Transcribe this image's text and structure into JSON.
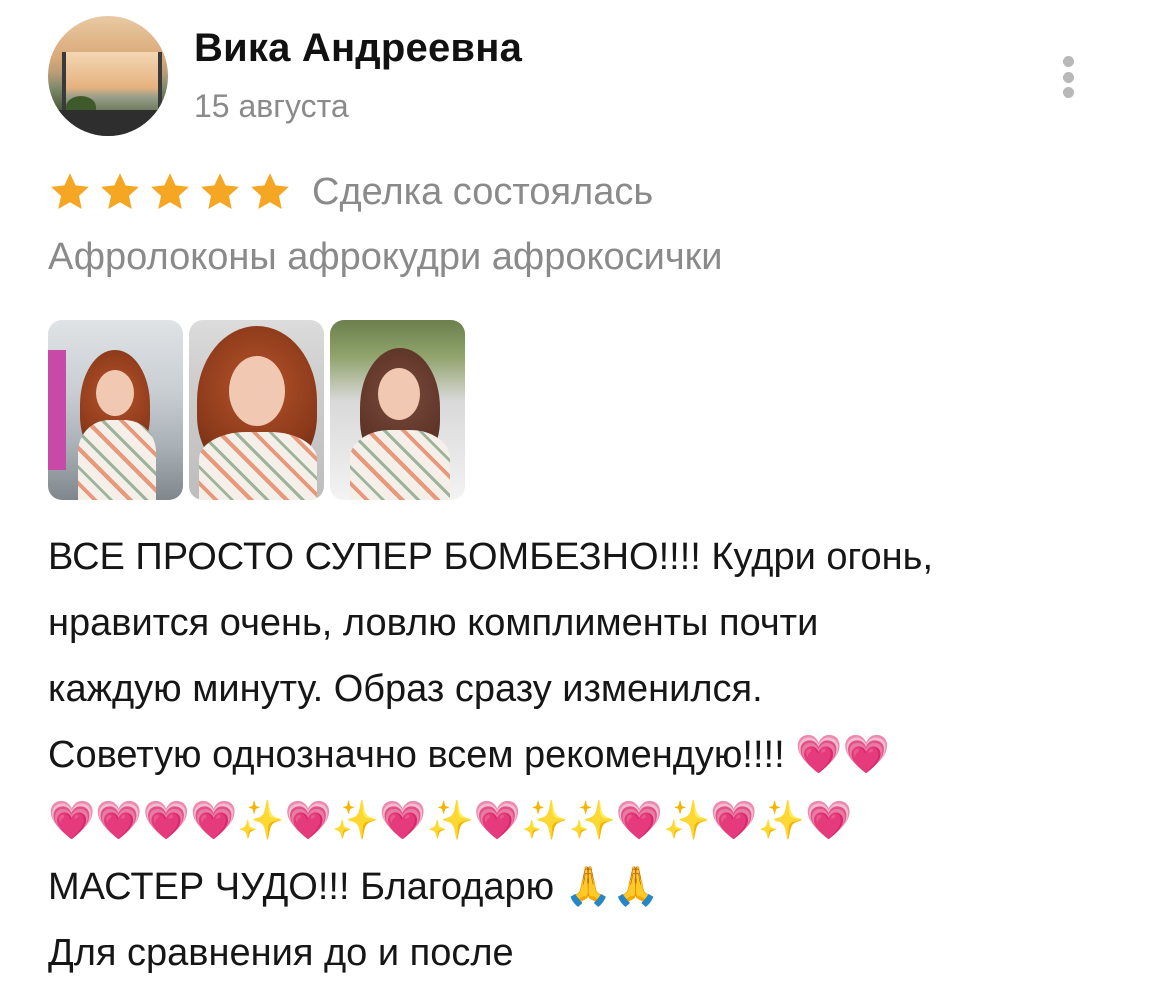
{
  "review": {
    "author_name": "Вика Андреевна",
    "date": "15 августа",
    "rating": 5,
    "rating_max": 5,
    "star_color": "#F5A623",
    "deal_status": "Сделка состоялась",
    "service": "Афролоконы афрокудри афрокосички",
    "photo_count": 3,
    "text_lines": [
      "ВСЕ ПРОСТО СУПЕР БОМБЕЗНО!!!! Кудри огонь,",
      "нравится очень, ловлю комплименты почти",
      "каждую минуту. Образ сразу изменился.",
      "Советую однозначно всем рекомендую!!!! 💗💗",
      "💗💗💗💗✨💗✨💗✨💗✨✨💗✨💗✨💗",
      "МАСТЕР ЧУДО!!! Благодарю 🙏🙏",
      "Для сравнения до и после"
    ]
  },
  "icons": {
    "more": "more-vertical-icon",
    "star": "star-icon"
  }
}
